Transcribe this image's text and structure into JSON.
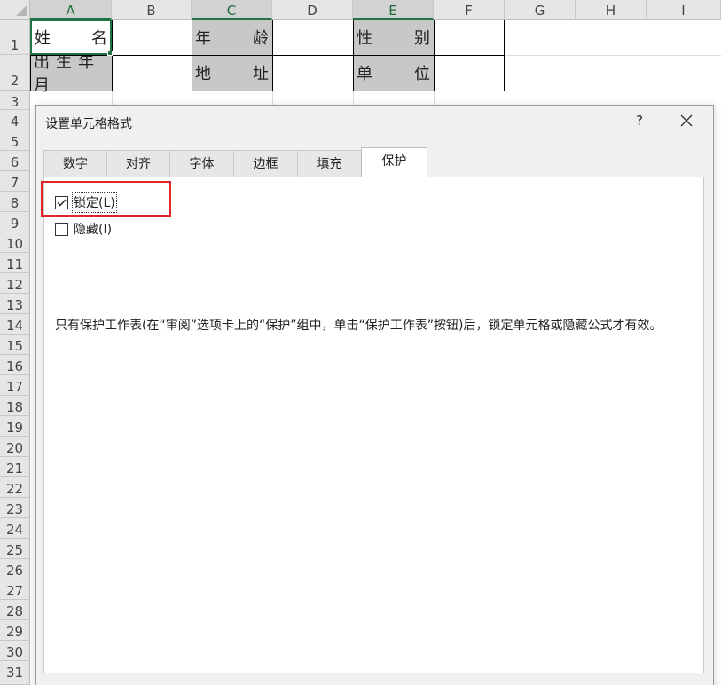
{
  "sheet": {
    "columns": [
      "A",
      "B",
      "C",
      "D",
      "E",
      "F",
      "G",
      "H",
      "I"
    ],
    "rows": [
      "1",
      "2",
      "3",
      "4",
      "5",
      "6",
      "7",
      "8",
      "9",
      "10",
      "11",
      "12",
      "13",
      "14",
      "15",
      "16",
      "17",
      "18",
      "19",
      "20",
      "21",
      "22",
      "23",
      "24",
      "25",
      "26",
      "27",
      "28",
      "29",
      "30",
      "31"
    ],
    "cells": {
      "A1": [
        "姓",
        "名"
      ],
      "C1": [
        "年",
        "龄"
      ],
      "E1": [
        "性",
        "别"
      ],
      "A2": "出生年月",
      "C2": [
        "地",
        "址"
      ],
      "E2": [
        "单",
        "位"
      ]
    }
  },
  "dialog": {
    "title": "设置单元格格式",
    "help_label": "?",
    "tabs": [
      "数字",
      "对齐",
      "字体",
      "边框",
      "填充",
      "保护"
    ],
    "active_tab": "保护",
    "protection": {
      "locked_label": "锁定(L)",
      "locked_checked": true,
      "hidden_label": "隐藏(I)",
      "hidden_checked": false,
      "note": "只有保护工作表(在“审阅”选项卡上的“保护”组中，单击“保护工作表”按钮)后，锁定单元格或隐藏公式才有效。"
    }
  },
  "colors": {
    "accent_green": "#217346",
    "highlight_red": "#e0262a",
    "header_cell_grey": "#c8c8c8"
  },
  "icons": {
    "close": "close-icon",
    "check": "checkmark-icon",
    "corner": "select-all-triangle-icon"
  }
}
